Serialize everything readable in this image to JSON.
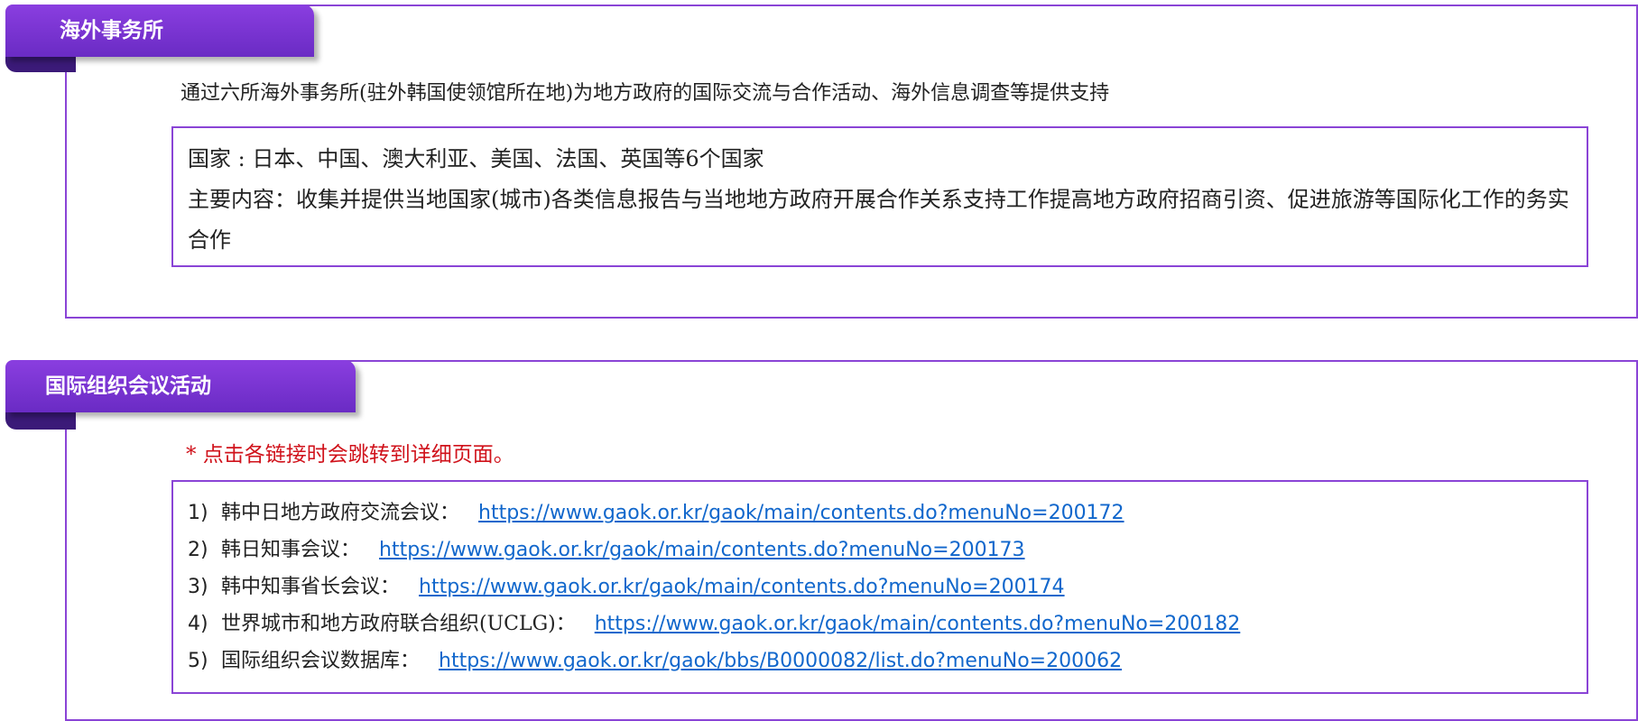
{
  "section_overseas": {
    "title": "海外事务所",
    "intro": "通过六所海外事务所(驻外韩国使领馆所在地)为地方政府的国际交流与合作活动、海外信息调查等提供支持",
    "countries": "国家 : 日本、中国、澳大利亚、美国、法国、英国等6个国家",
    "main_content": "主要内容：收集并提供当地国家(城市)各类信息报告与当地地方政府开展合作关系支持工作提高地方政府招商引资、促进旅游等国际化工作的务实合作"
  },
  "section_intl": {
    "title": "国际组织会议活动",
    "notice": "* 点击各链接时会跳转到详细页面。",
    "links": [
      {
        "num": "1)",
        "label": "韩中日地方政府交流会议：",
        "url": "https://www.gaok.or.kr/gaok/main/contents.do?menuNo=200172"
      },
      {
        "num": "2)",
        "label": "韩日知事会议：",
        "url": "https://www.gaok.or.kr/gaok/main/contents.do?menuNo=200173"
      },
      {
        "num": "3)",
        "label": "韩中知事省长会议：",
        "url": "https://www.gaok.or.kr/gaok/main/contents.do?menuNo=200174"
      },
      {
        "num": "4)",
        "label": "世界城市和地方政府联合组织(UCLG)：",
        "url": "https://www.gaok.or.kr/gaok/main/contents.do?menuNo=200182"
      },
      {
        "num": "5)",
        "label": "国际组织会议数据库：",
        "url": "https://www.gaok.or.kr/gaok/bbs/B0000082/list.do?menuNo=200062"
      }
    ]
  },
  "colors": {
    "accent": "#8a44d6",
    "tab_dark": "#3b1a78",
    "notice_red": "#d0121b",
    "link_blue": "#1167cc"
  }
}
